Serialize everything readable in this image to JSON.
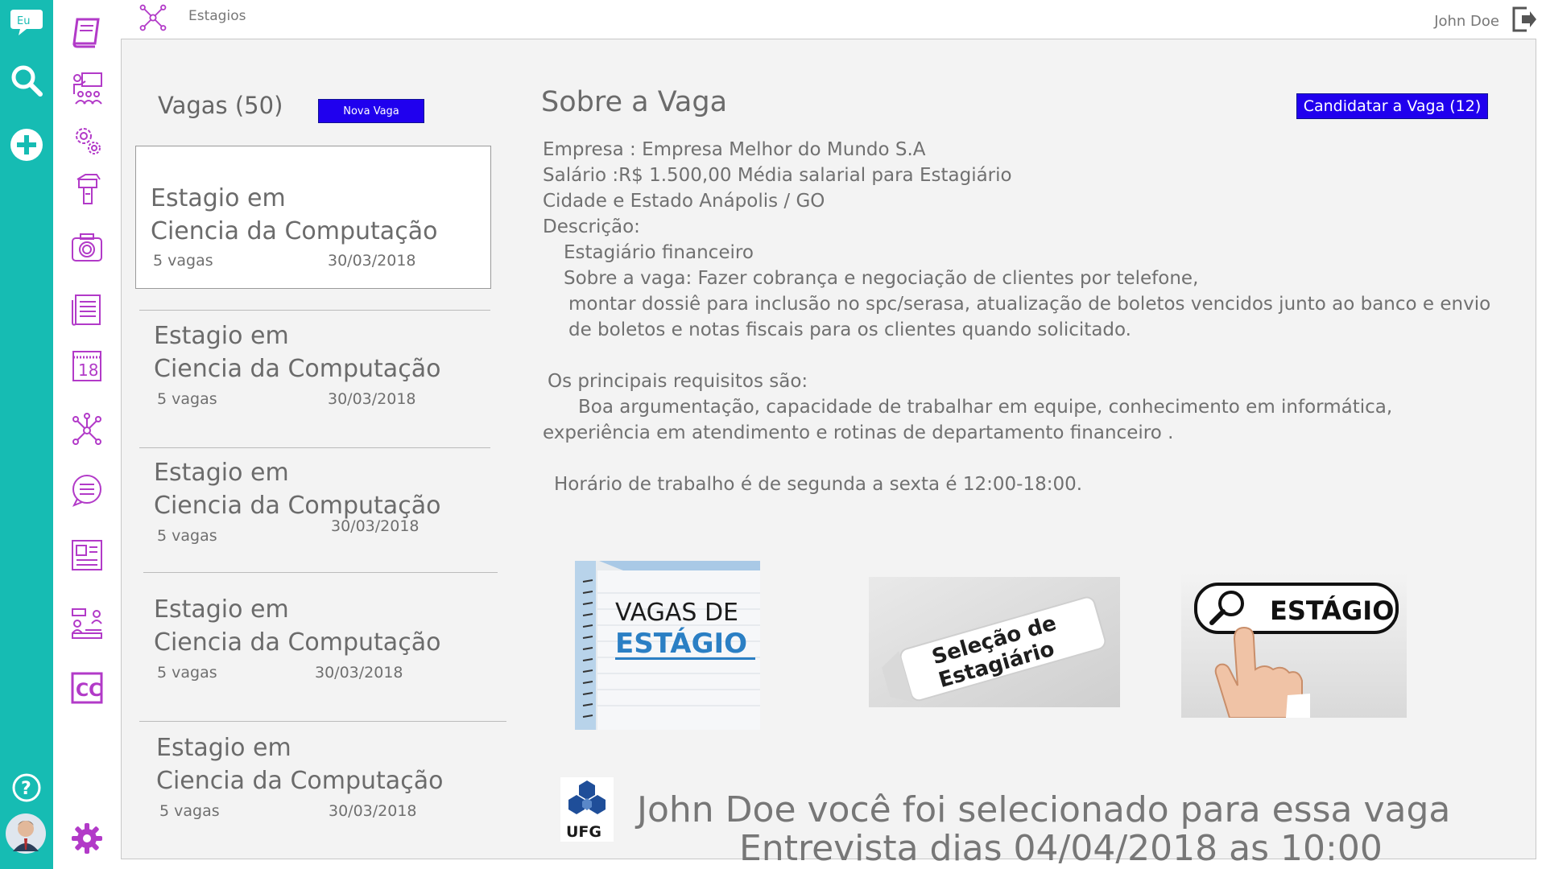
{
  "app": {
    "logo_text": "Eu"
  },
  "breadcrumb": {
    "label": "Estagios"
  },
  "user": {
    "name": "John Doe"
  },
  "rail": {
    "items": [
      {
        "icon": "chat-logo-icon"
      },
      {
        "icon": "search-icon"
      },
      {
        "icon": "add-circle-icon"
      },
      {
        "icon": "help-icon"
      },
      {
        "icon": "avatar"
      }
    ]
  },
  "nav": {
    "calendar_day": "18",
    "cc_label": "CC",
    "items": [
      "book-icon",
      "presentation-icon",
      "settings-gears-icon",
      "hand-tools-icon",
      "camera-icon",
      "newspaper-icon",
      "calendar-icon",
      "network-icon",
      "chat-list-icon",
      "news-columns-icon",
      "people-icon",
      "cc-icon",
      "gear-icon"
    ]
  },
  "list": {
    "title": "Vagas (50)",
    "new_button": "Nova Vaga",
    "jobs": [
      {
        "title1": "Estagio em",
        "title2": "Ciencia da Computação",
        "vagas": "5 vagas",
        "date": "30/03/2018"
      },
      {
        "title1": "Estagio em",
        "title2": "Ciencia da Computação",
        "vagas": "5 vagas",
        "date": "30/03/2018"
      },
      {
        "title1": "Estagio em",
        "title2": "Ciencia da Computação",
        "vagas": "5 vagas",
        "date": "30/03/2018"
      },
      {
        "title1": "Estagio em",
        "title2": "Ciencia da Computação",
        "vagas": "5 vagas",
        "date": "30/03/2018"
      },
      {
        "title1": "Estagio em",
        "title2": "Ciencia da Computação",
        "vagas": "5 vagas",
        "date": "30/03/2018"
      }
    ]
  },
  "detail": {
    "title": "Sobre a Vaga",
    "apply_button": "Candidatar a Vaga (12)",
    "lines": [
      "Empresa   : Empresa Melhor do Mundo S.A",
      "Salário      :R$ 1.500,00 Média salarial para Estagiário",
      "Cidade e Estado  Anápolis / GO",
      "Descrição:",
      "Estagiário financeiro",
      "Sobre a vaga: Fazer cobrança e negociação de clientes por telefone,",
      "montar dossiê para inclusão no spc/serasa, atualização de boletos vencidos junto ao banco e envio",
      "de boletos e notas fiscais para os clientes quando solicitado.",
      "Os principais requisitos são:",
      "Boa argumentação, capacidade de trabalhar em equipe, conhecimento em informática,",
      "experiência em atendimento e rotinas de departamento financeiro .",
      "Horário de trabalho é de segunda a sexta é 12:00-18:00."
    ]
  },
  "images": {
    "vagas_line1": "VAGAS DE",
    "vagas_line2": "ESTÁGIO",
    "selecao_line1": "Seleção de",
    "selecao_line2": "Estagiário",
    "search_word": "ESTÁGIO"
  },
  "footer": {
    "logo_text": "UFG",
    "message_line1": "John Doe você foi selecionado para essa vaga",
    "message_line2": "Entrevista dias 04/04/2018 as 10:00"
  },
  "colors": {
    "accent_teal": "#16bcb3",
    "nav_purple": "#b23ac8",
    "button_blue": "#2000ee"
  }
}
